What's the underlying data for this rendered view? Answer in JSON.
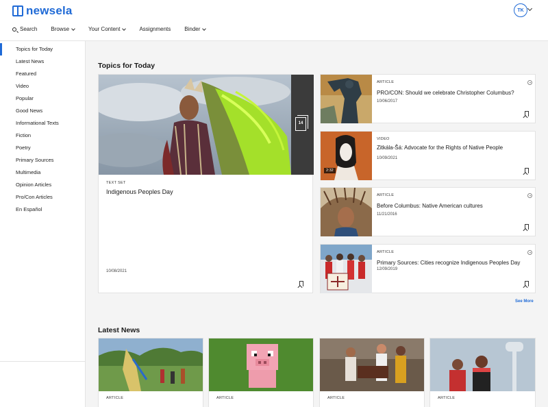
{
  "app": {
    "logo_text": "newsela"
  },
  "user": {
    "initials": "TK"
  },
  "nav": {
    "search": "Search",
    "browse": "Browse",
    "your_content": "Your Content",
    "assignments": "Assignments",
    "binder": "Binder"
  },
  "sidebar": {
    "items": [
      {
        "label": "Topics for Today",
        "active": true
      },
      {
        "label": "Latest News"
      },
      {
        "label": "Featured"
      },
      {
        "label": "Video"
      },
      {
        "label": "Popular"
      },
      {
        "label": "Good News"
      },
      {
        "label": "Informational Texts"
      },
      {
        "label": "Fiction"
      },
      {
        "label": "Poetry"
      },
      {
        "label": "Primary Sources"
      },
      {
        "label": "Multimedia"
      },
      {
        "label": "Opinion Articles"
      },
      {
        "label": "Pro/Con Articles"
      },
      {
        "label": "En Español"
      }
    ]
  },
  "topics": {
    "title": "Topics for Today",
    "featured": {
      "kicker": "TEXT SET",
      "title": "Indigenous Peoples Day",
      "date": "10/08/2021",
      "count": "14"
    },
    "items": [
      {
        "kicker": "ARTICLE",
        "title": "PRO/CON: Should we celebrate Christopher Columbus?",
        "date": "10/06/2017"
      },
      {
        "kicker": "VIDEO",
        "title": "Zitkála-Šá: Advocate for the Rights of Native People",
        "date": "10/09/2021",
        "duration": "2:32"
      },
      {
        "kicker": "ARTICLE",
        "title": "Before Columbus: Native American cultures",
        "date": "11/21/2016"
      },
      {
        "kicker": "ARTICLE",
        "title": "Primary Sources: Cities recognize Indigenous Peoples Day",
        "date": "12/09/2019"
      }
    ],
    "see_more": "See More"
  },
  "latest": {
    "title": "Latest News",
    "items": [
      {
        "kicker": "ARTICLE"
      },
      {
        "kicker": "ARTICLE"
      },
      {
        "kicker": "ARTICLE"
      },
      {
        "kicker": "ARTICLE"
      }
    ]
  },
  "colors": {
    "brand": "#1f6ad6"
  }
}
